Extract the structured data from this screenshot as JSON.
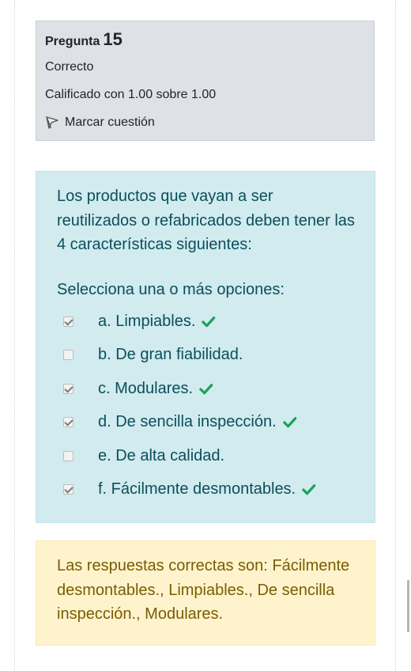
{
  "info": {
    "question_label": "Pregunta",
    "question_number": "15",
    "state": "Correcto",
    "grade": "Calificado con 1.00 sobre 1.00",
    "flag_label": "Marcar cuestión"
  },
  "question": {
    "text": "Los productos que vayan a ser reutilizados o refabricados deben tener las 4 características siguientes:",
    "prompt": "Selecciona una o más opciones:",
    "options": [
      {
        "label": "a. Limpiables.",
        "checked": true,
        "correct_mark": true
      },
      {
        "label": "b. De gran fiabilidad.",
        "checked": false,
        "correct_mark": false
      },
      {
        "label": "c. Modulares.",
        "checked": true,
        "correct_mark": true
      },
      {
        "label": "d. De sencilla inspección.",
        "checked": true,
        "correct_mark": true
      },
      {
        "label": "e. De alta calidad.",
        "checked": false,
        "correct_mark": false
      },
      {
        "label": "f. Fácilmente desmontables.",
        "checked": true,
        "correct_mark": true
      }
    ]
  },
  "feedback": {
    "text": "Las respuestas correctas son: Fácilmente desmontables., Limpiables., De sencilla inspección., Modulares."
  },
  "colors": {
    "info_bg": "#dee2e6",
    "content_bg": "#d1ebef",
    "feedback_bg": "#fff3cd",
    "correct_check": "#1aa35a"
  },
  "icons": {
    "flag": "flag-icon",
    "correct": "check-icon"
  }
}
